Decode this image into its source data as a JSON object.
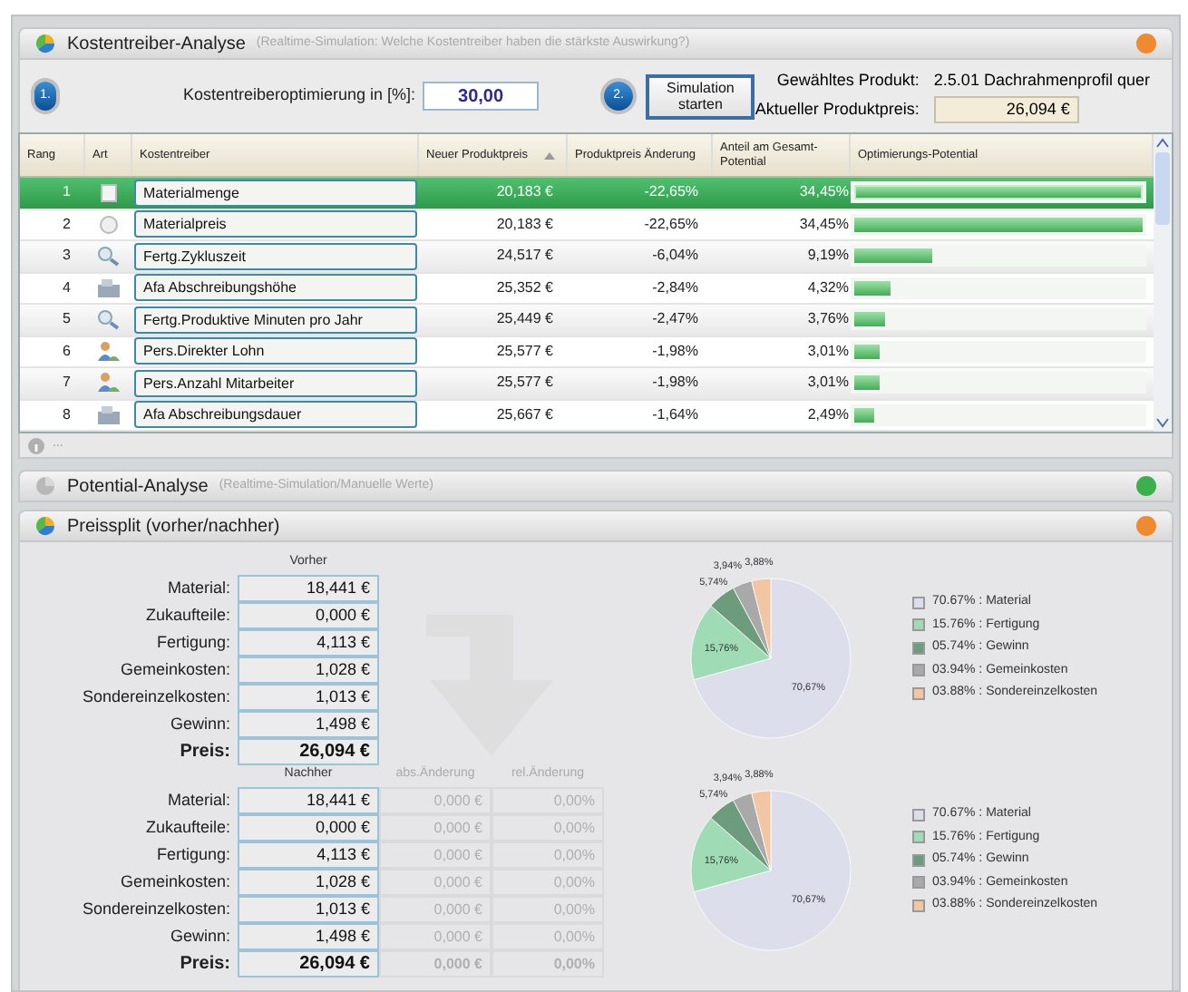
{
  "kostentreiber": {
    "title": "Kostentreiber-Analyse",
    "subtitle": "(Realtime-Simulation: Welche Kostentreiber haben die stärkste Auswirkung?)",
    "color": "#f08a30",
    "step1": "1.",
    "opt_label": "Kostentreiberoptimierung in [%]:",
    "opt_value": "30,00",
    "step2": "2.",
    "sim_button": "Simulation starten",
    "product_label": "Gewähltes Produkt:",
    "product_value": "2.5.01 Dachrahmenprofil quer",
    "price_label": "Aktueller Produktpreis:",
    "price_value": "26,094 €",
    "table": {
      "columns": [
        "Rang",
        "Art",
        "Kostentreiber",
        "Neuer Produktpreis",
        "Produktpreis Änderung",
        "Anteil am Gesamt-Potential",
        "Optimierungs-Potential"
      ],
      "rows": [
        {
          "rank": "1",
          "kind": "box",
          "name": "Materialmenge",
          "price": "20,183 €",
          "change": "-22,65%",
          "share": "34,45%",
          "level": 1,
          "selected": true
        },
        {
          "rank": "2",
          "kind": "coin",
          "name": "Materialpreis",
          "price": "20,183 €",
          "change": "-22,65%",
          "share": "34,45%",
          "level": 1,
          "selected": false
        },
        {
          "rank": "3",
          "kind": "search",
          "name": "Fertg.Zykluszeit",
          "price": "24,517 €",
          "change": "-6,04%",
          "share": "9,19%",
          "level": 0.27,
          "selected": false
        },
        {
          "rank": "4",
          "kind": "machine",
          "name": "Afa Abschreibungshöhe",
          "price": "25,352 €",
          "change": "-2,84%",
          "share": "4,32%",
          "level": 0.125,
          "selected": false
        },
        {
          "rank": "5",
          "kind": "search",
          "name": "Fertg.Produktive Minuten pro Jahr",
          "price": "25,449 €",
          "change": "-2,47%",
          "share": "3,76%",
          "level": 0.11,
          "selected": false
        },
        {
          "rank": "6",
          "kind": "people",
          "name": "Pers.Direkter Lohn",
          "price": "25,577 €",
          "change": "-1,98%",
          "share": "3,01%",
          "level": 0.087,
          "selected": false
        },
        {
          "rank": "7",
          "kind": "people",
          "name": "Pers.Anzahl Mitarbeiter",
          "price": "25,577 €",
          "change": "-1,98%",
          "share": "3,01%",
          "level": 0.087,
          "selected": false
        },
        {
          "rank": "8",
          "kind": "machine",
          "name": "Afa Abschreibungsdauer",
          "price": "25,667 €",
          "change": "-1,64%",
          "share": "2,49%",
          "level": 0.072,
          "selected": false
        }
      ]
    },
    "footer": "..."
  },
  "potential": {
    "title": "Potential-Analyse",
    "subtitle": "(Realtime-Simulation/Manuelle Werte)",
    "color": "#3cb04a"
  },
  "preissplit": {
    "title": "Preissplit (vorher/nachher)",
    "color": "#f08a30",
    "blocks": [
      {
        "heading": "Vorher",
        "rows": [
          {
            "label": "Material:",
            "value": "18,441 €",
            "kind": "item"
          },
          {
            "label": "Zukaufteile:",
            "value": "0,000 €",
            "kind": "item"
          },
          {
            "label": "Fertigung:",
            "value": "4,113 €",
            "kind": "item"
          },
          {
            "label": "Gemeinkosten:",
            "value": "1,028 €",
            "kind": "item"
          },
          {
            "label": "Sondereinzelkosten:",
            "value": "1,013 €",
            "kind": "item"
          },
          {
            "label": "Gewinn:",
            "value": "1,498 €",
            "kind": "item"
          },
          {
            "label": "Preis:",
            "value": "26,094 €",
            "kind": "total"
          }
        ],
        "chart_data": {
          "type": "pie",
          "values": [
            70.67,
            15.76,
            5.74,
            3.94,
            3.88
          ],
          "value_labels": [
            "70,67%",
            "15,76%",
            "5,74%",
            "3,94%",
            "3,88%"
          ]
        },
        "legend": [
          {
            "text": "70.67% : Material",
            "color": "#dcdeec"
          },
          {
            "text": "15.76% : Fertigung",
            "color": "#9fdcb6"
          },
          {
            "text": "05.74% : Gewinn",
            "color": "#6d9c7c"
          },
          {
            "text": "03.94% : Gemeinkosten",
            "color": "#a9a9a9"
          },
          {
            "text": "03.88% : Sondereinzelkosten",
            "color": "#f2c6a2"
          }
        ]
      },
      {
        "heading": "Nachher",
        "extra_headings": [
          "abs.Änderung",
          "rel.Änderung"
        ],
        "rows": [
          {
            "label": "Material:",
            "value": "18,441 €",
            "abs": "0,000 €",
            "rel": "0,00%",
            "kind": "item"
          },
          {
            "label": "Zukaufteile:",
            "value": "0,000 €",
            "abs": "0,000 €",
            "rel": "0,00%",
            "kind": "item"
          },
          {
            "label": "Fertigung:",
            "value": "4,113 €",
            "abs": "0,000 €",
            "rel": "0,00%",
            "kind": "item"
          },
          {
            "label": "Gemeinkosten:",
            "value": "1,028 €",
            "abs": "0,000 €",
            "rel": "0,00%",
            "kind": "item"
          },
          {
            "label": "Sondereinzelkosten:",
            "value": "1,013 €",
            "abs": "0,000 €",
            "rel": "0,00%",
            "kind": "item"
          },
          {
            "label": "Gewinn:",
            "value": "1,498 €",
            "abs": "0,000 €",
            "rel": "0,00%",
            "kind": "item"
          },
          {
            "label": "Preis:",
            "value": "26,094 €",
            "abs": "0,000 €",
            "rel": "0,00%",
            "kind": "total"
          }
        ],
        "chart_data": {
          "type": "pie",
          "values": [
            70.67,
            15.76,
            5.74,
            3.94,
            3.88
          ],
          "value_labels": [
            "70,67%",
            "15,76%",
            "5,74%",
            "3,94%",
            "3,88%"
          ]
        },
        "legend": [
          {
            "text": "70.67% : Material",
            "color": "#dcdeec"
          },
          {
            "text": "15.76% : Fertigung",
            "color": "#9fdcb6"
          },
          {
            "text": "05.74% : Gewinn",
            "color": "#6d9c7c"
          },
          {
            "text": "03.94% : Gemeinkosten",
            "color": "#a9a9a9"
          },
          {
            "text": "03.88% : Sondereinzelkosten",
            "color": "#f2c6a2"
          }
        ]
      }
    ]
  }
}
